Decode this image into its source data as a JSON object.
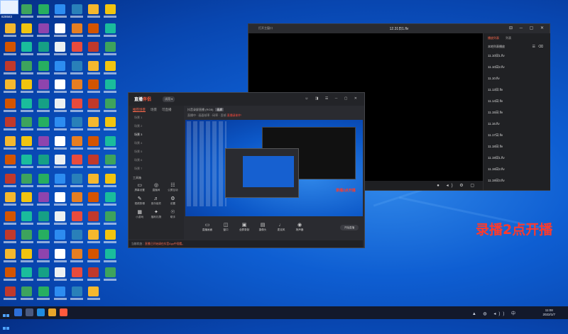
{
  "desktop": {
    "user_number": "828583",
    "icons_note": ""
  },
  "player": {
    "sidebar_label": "打开主窗口",
    "title": "12.31日1.flv",
    "tab_list": "播放列表",
    "tab_other": "列表",
    "playlist_head": "本地列表播放",
    "items": [
      "11.10日1.flv",
      "11.10日2.flv",
      "11.10.flv",
      "11.13日.flv",
      "11.14日.flv",
      "11.15日.flv",
      "11.16.flv",
      "11.17日.flv",
      "11.18日.flv",
      "11.19日1.flv",
      "11.19日2.flv",
      "11.19日3.flv"
    ]
  },
  "recorder": {
    "logo_a": "直播",
    "logo_b": "伴侣",
    "version": "试用 ▾",
    "tabs": [
      "推荐场景",
      "场景",
      "可直播"
    ],
    "scenes": [
      "场景 1",
      "场景 2",
      "场景 3",
      "场景 4",
      "场景 5",
      "场景 6",
      "场景 7"
    ],
    "tools_header": "工具箱",
    "tools": [
      {
        "glyph": "▭",
        "label": "屏幕设置"
      },
      {
        "glyph": "◎",
        "label": "直播间"
      },
      {
        "glyph": "☷",
        "label": "公屏互动"
      },
      {
        "glyph": "✎",
        "label": "视频剪辑"
      },
      {
        "glyph": "♬",
        "label": "音乐组件"
      },
      {
        "glyph": "⚙",
        "label": "设置"
      },
      {
        "glyph": "▦",
        "label": "小游戏"
      },
      {
        "glyph": "✦",
        "label": "福利礼物"
      },
      {
        "glyph": "☉",
        "label": "助手"
      }
    ],
    "room_name": "抖音录屏直播 (RGB)",
    "room_tag": "画质",
    "stats": "直播中 · 画面帧率 · 码率 · 丢帧",
    "stats_red": "直播录制中",
    "controls": [
      {
        "glyph": "▭",
        "label": "直播画面"
      },
      {
        "glyph": "◫",
        "label": "窗口"
      },
      {
        "glyph": "▣",
        "label": "全屏录制"
      },
      {
        "glyph": "▤",
        "label": "摄像头"
      },
      {
        "glyph": "♩",
        "label": "麦克风"
      },
      {
        "glyph": "◉",
        "label": "扬声器"
      }
    ],
    "go_live": "开始直播",
    "info": "当前状态",
    "info_warn": "直播已开始请在抖音App中观看。",
    "overlay_in_preview": "录播2点开播"
  },
  "overlay_text": "录播2点开播",
  "taskbar": {
    "time": "11:08",
    "date": "2022/1/7",
    "tray": "▲ ◍ ◂)) 中"
  }
}
